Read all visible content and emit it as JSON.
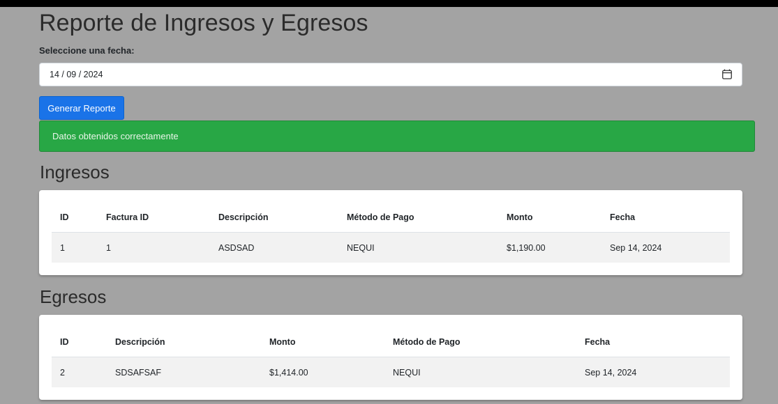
{
  "page": {
    "title": "Reporte de Ingresos y Egresos",
    "date_label": "Seleccione una fecha:",
    "date_value": "14 / 09 / 2024",
    "generate_button": "Generar Reporte",
    "alert_message": "Datos obtenidos correctamente"
  },
  "ingresos": {
    "title": "Ingresos",
    "headers": [
      "ID",
      "Factura ID",
      "Descripción",
      "Método de Pago",
      "Monto",
      "Fecha"
    ],
    "rows": [
      [
        "1",
        "1",
        "ASDSAD",
        "NEQUI",
        "$1,190.00",
        "Sep 14, 2024"
      ]
    ]
  },
  "egresos": {
    "title": "Egresos",
    "headers": [
      "ID",
      "Descripción",
      "Monto",
      "Método de Pago",
      "Fecha"
    ],
    "rows": [
      [
        "2",
        "SDSAFSAF",
        "$1,414.00",
        "NEQUI",
        "Sep 14, 2024"
      ]
    ]
  },
  "colors": {
    "background": "#a3a3a3",
    "button": "#1a73e8",
    "alert_success": "#28a745"
  },
  "icons": {
    "date_picker": "calendar-icon"
  }
}
